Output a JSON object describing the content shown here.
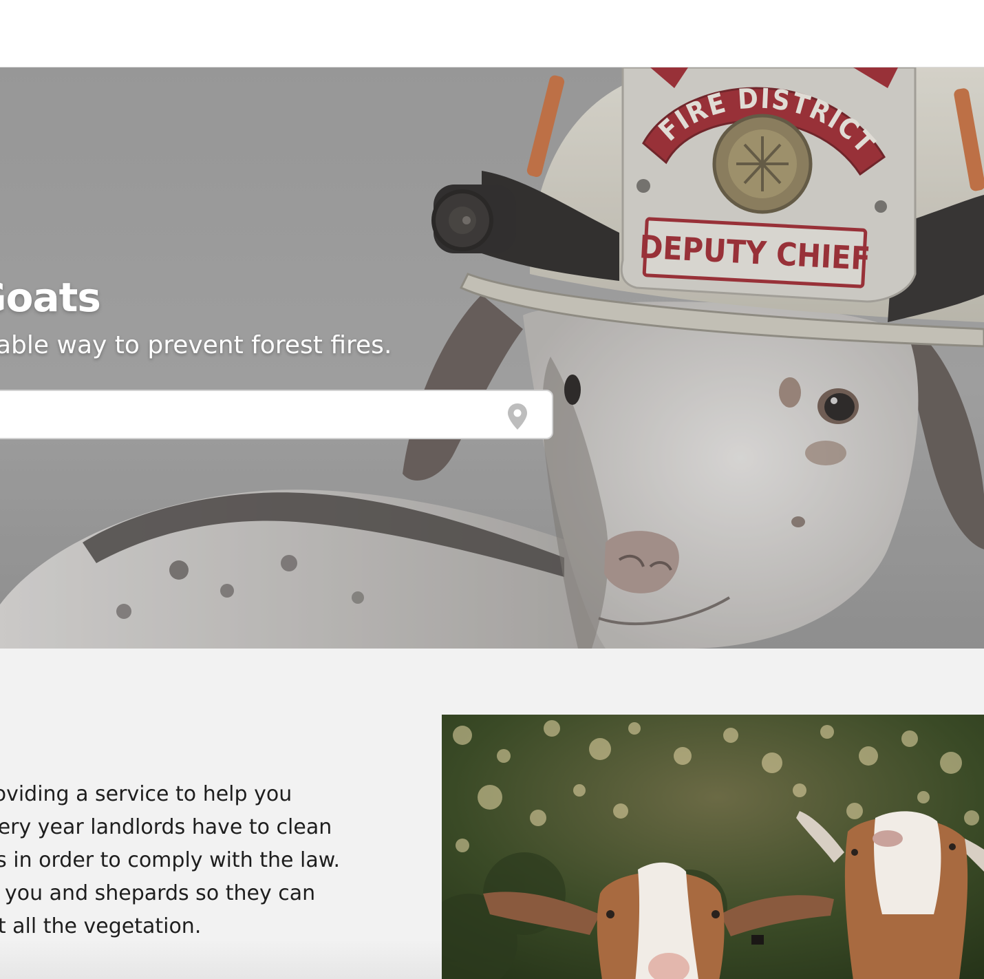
{
  "hero": {
    "title": "Goats",
    "subtitle": "able way to prevent forest fires.",
    "search": {
      "value": "",
      "placeholder": ""
    },
    "helmet_badge": {
      "arc_text": "FIRE DISTRICT",
      "plate_text": "DEPUTY CHIEF"
    }
  },
  "about": {
    "lines": [
      "providing a service to help you",
      " Every year landlords have to clean",
      "ses in order to comply with the law.",
      "en you and shepards so they can",
      " eat all the vegetation."
    ]
  },
  "icons": {
    "search_pin": "location-pin-icon"
  },
  "colors": {
    "hero_overlay": "#9a9a9a",
    "helmet": "#dcd9cc",
    "badge_red": "#9c1e26",
    "about_bg": "#f2f2f2",
    "text": "#1e1e1e"
  }
}
